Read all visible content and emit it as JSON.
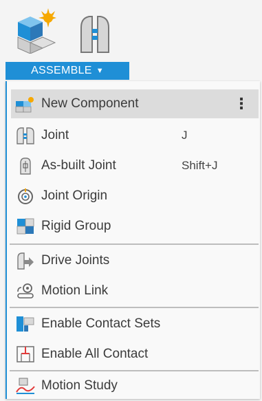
{
  "toolbar": {
    "icons": [
      "new-component-large-icon",
      "joint-large-icon"
    ],
    "tab_label": "ASSEMBLE",
    "accent": "#1f8fd6"
  },
  "menu": {
    "items": [
      {
        "label": "New Component",
        "icon": "new-component-icon",
        "shortcut": "",
        "more": "⋮"
      },
      {
        "label": "Joint",
        "icon": "joint-icon",
        "shortcut": "J"
      },
      {
        "label": "As-built Joint",
        "icon": "as-built-joint-icon",
        "shortcut": "Shift+J"
      },
      {
        "label": "Joint Origin",
        "icon": "joint-origin-icon",
        "shortcut": ""
      },
      {
        "label": "Rigid Group",
        "icon": "rigid-group-icon",
        "shortcut": ""
      },
      {
        "label": "Drive Joints",
        "icon": "drive-joints-icon",
        "shortcut": ""
      },
      {
        "label": "Motion Link",
        "icon": "motion-link-icon",
        "shortcut": ""
      },
      {
        "label": "Enable Contact Sets",
        "icon": "enable-contact-sets-icon",
        "shortcut": ""
      },
      {
        "label": "Enable All Contact",
        "icon": "enable-all-contact-icon",
        "shortcut": ""
      },
      {
        "label": "Motion Study",
        "icon": "motion-study-icon",
        "shortcut": ""
      }
    ]
  }
}
